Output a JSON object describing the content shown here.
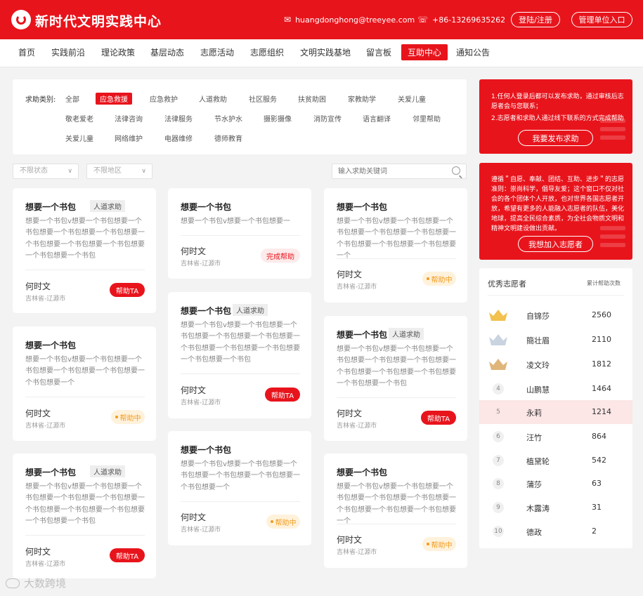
{
  "header": {
    "title": "新时代文明实践中心",
    "email": "huangdonghong@treeyee.com",
    "phone": "+86-13269635262",
    "login_label": "登陆/注册",
    "admin_label": "管理单位入口"
  },
  "nav": [
    "首页",
    "实践前沿",
    "理论政策",
    "基层动态",
    "志愿活动",
    "志愿组织",
    "文明实践基地",
    "留言板",
    "互助中心",
    "通知公告"
  ],
  "filter": {
    "label": "求助类别:",
    "row1": [
      "全部",
      "应急救援",
      "应急救护",
      "人道救助",
      "社区服务",
      "扶贫助困",
      "家教助学",
      "关爱儿童"
    ],
    "row2": [
      "敬老爱老",
      "法律咨询",
      "法律服务",
      "节水护水",
      "摄影摄像",
      "消防宣传",
      "语言翻译",
      "邻里帮助"
    ],
    "row3": [
      "关爱儿童",
      "网络维护",
      "电器维修",
      "德师教育"
    ]
  },
  "selects": {
    "status": "不限状态",
    "region": "不限地区"
  },
  "search": {
    "placeholder": "输入求助关键词"
  },
  "cards": [
    {
      "title": "想要一个书包",
      "tag": "人道求助",
      "desc": "想要一个书包v想要一个书包想要一个书包想要一个书包想要一个书包想要一个书包想要一个书包想要一个书包想要一个书包想要一个书包",
      "name": "何时文",
      "location": "吉林省-辽源市",
      "status": "帮助TA"
    },
    {
      "title": "想要一个书包",
      "tag": "",
      "desc": "想要一个书包v想要一个书包想要一个书包想要一个书包想要一个书包想要一个书包想要一个",
      "name": "何时文",
      "location": "吉林省-辽源市",
      "status": "帮助中"
    },
    {
      "title": "想要一个书包",
      "tag": "人道求助",
      "desc": "想要一个书包v想要一个书包想要一个书包想要一个书包想要一个书包想要一个书包想要一个书包想要一个书包想要一个书包想要一个书包",
      "name": "何时文",
      "location": "吉林省-辽源市",
      "status": "帮助TA"
    },
    {
      "title": "想要一个书包",
      "tag": "",
      "desc": "想要一个书包v想要一个书包想要一",
      "name": "何时文",
      "location": "吉林省-辽源市",
      "status": "完成帮助"
    },
    {
      "title": "想要一个书包",
      "tag": "人道求助",
      "desc": "想要一个书包v想要一个书包想要一个书包想要一个书包想要一个书包想要一个书包想要一个书包想要一个书包想要一个书包想要一个书包",
      "name": "何时文",
      "location": "吉林省-辽源市",
      "status": "帮助TA"
    },
    {
      "title": "想要一个书包",
      "tag": "",
      "desc": "想要一个书包v想要一个书包想要一个书包想要一个书包想要一个书包想要一个书包想要一个",
      "name": "何时文",
      "location": "吉林省-辽源市",
      "status": "帮助中"
    },
    {
      "title": "想要一个书包",
      "tag": "",
      "desc": "想要一个书包v想要一个书包想要一个书包想要一个书包想要一个书包想要一个书包想要一个书包想要一个书包想要一个",
      "name": "何时文",
      "location": "吉林省-辽源市",
      "status": "帮助中"
    },
    {
      "title": "想要一个书包",
      "tag": "人道求助",
      "desc": "想要一个书包v想要一个书包想要一个书包想要一个书包想要一个书包想要一个书包想要一个书包想要一个书包想要一个书包想要一个书包",
      "name": "何时文",
      "location": "吉林省-辽源市",
      "status": "帮助TA"
    },
    {
      "title": "想要一个书包",
      "tag": "",
      "desc": "想要一个书包v想要一个书包想要一个书包想要一个书包想要一个书包想要一个书包想要一个书包想要一个书包想要一个",
      "name": "何时文",
      "location": "吉林省-辽源市",
      "status": "帮助中"
    }
  ],
  "sidebar": {
    "banner1": {
      "line1": "1.任何人登录后都可以发布求助，通过审核后志愿者会与您联系；",
      "line2": "2.志愿者和求助人通过线下联系的方式完成帮助",
      "button": "我要发布求助"
    },
    "banner2": {
      "text": "遵循＂自愿、奉献、团结、互助、进步＂的志愿准则：崇尚科学，倡导友爱；这个窗口不仅对社会的各个团体个人开放，也对世界各国志愿者开放，希望有更多的人能融入志愿者的队伍，美化地球，提高全民综合素质，为全社会物质文明和精神文明建设做出贡献。",
      "button": "我想加入志愿者"
    },
    "ranking": {
      "title": "优秀志愿者",
      "subtitle": "累计帮助次数",
      "rows": [
        {
          "rank": "1",
          "name": "自锦莎",
          "count": "2560"
        },
        {
          "rank": "2",
          "name": "簡壮眉",
          "count": "2110"
        },
        {
          "rank": "3",
          "name": "凌文玲",
          "count": "1812"
        },
        {
          "rank": "4",
          "name": "山鹏慧",
          "count": "1464"
        },
        {
          "rank": "5",
          "name": "永莉",
          "count": "1214"
        },
        {
          "rank": "6",
          "name": "汪竹",
          "count": "864"
        },
        {
          "rank": "7",
          "name": "植黛轮",
          "count": "542"
        },
        {
          "rank": "8",
          "name": "蒲莎",
          "count": "63"
        },
        {
          "rank": "9",
          "name": "木露涛",
          "count": "31"
        },
        {
          "rank": "10",
          "name": "德政",
          "count": "2"
        }
      ]
    }
  },
  "watermark": "大数跨境",
  "colors": {
    "brand": "#e8141c",
    "progress": "#f39a1c",
    "gold": "#f2c14e",
    "silver": "#c9d4e0",
    "bronze": "#e0b57a"
  }
}
